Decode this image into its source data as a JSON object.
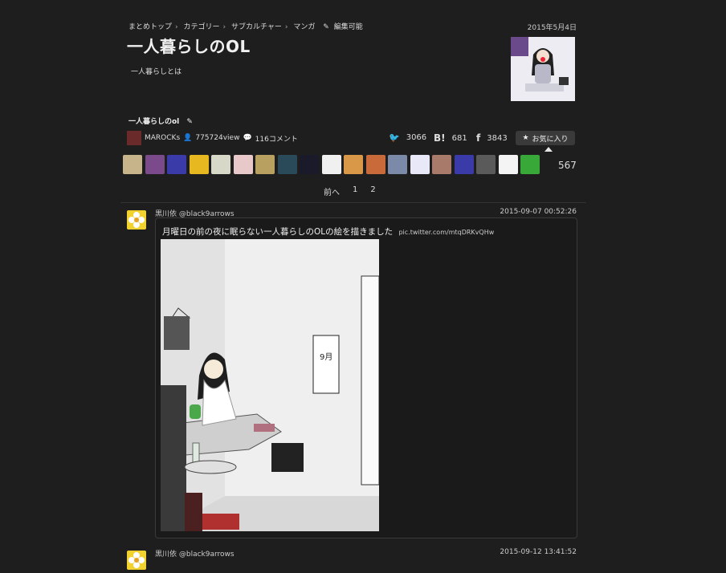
{
  "breadcrumb": [
    "まとめトップ",
    "カテゴリー",
    "サブカルチャー",
    "マンガ"
  ],
  "edit_label": "編集可能",
  "date_top": "2015年5月4日",
  "title": "一人暮らしのOL",
  "description": "一人暮らしとは",
  "subtitle": "一人暮らしのol",
  "author": {
    "name": "MAROCKs",
    "views": "775724view",
    "comments": "116コメント"
  },
  "share": {
    "twitter": "3066",
    "hatena_label": "B!",
    "hatena": "681",
    "facebook": "3843"
  },
  "favorite_label": "お気に入り",
  "favorite_count": "567",
  "favoriters": [
    "#c8b48a",
    "#7a4a8a",
    "#3a3aa8",
    "#e8b820",
    "#d8d8c8",
    "#e8c8c8",
    "#b8a060",
    "#2a4a5a",
    "#1a1a2a",
    "#f0f0f0",
    "#d89848",
    "#c86a3a",
    "#7a8aa8",
    "#e8e8f8",
    "#a87a6a",
    "#3a3aa8",
    "#5a5a5a",
    "#f4f4f4",
    "#38a838"
  ],
  "pager": {
    "prev": "前へ",
    "pages": [
      "1",
      "2"
    ]
  },
  "posts": [
    {
      "user": "黒川依 @black9arrows",
      "date": "2015-09-07 00:52:26",
      "text": "月曜日の前の夜に眠らない一人暮らしのOLの絵を描きました",
      "link": "pic.twitter.com/mtqDRKvQHw"
    },
    {
      "user": "黒川依 @black9arrows",
      "date": "2015-09-12 13:41:52"
    }
  ],
  "colors": {
    "background": "#1e1e1e",
    "accent_yellow": "#f2d22e"
  },
  "icons": [
    "chevron-right-icon",
    "pencil-icon",
    "user-icon",
    "comment-icon",
    "twitter-icon",
    "facebook-icon",
    "star-icon"
  ]
}
